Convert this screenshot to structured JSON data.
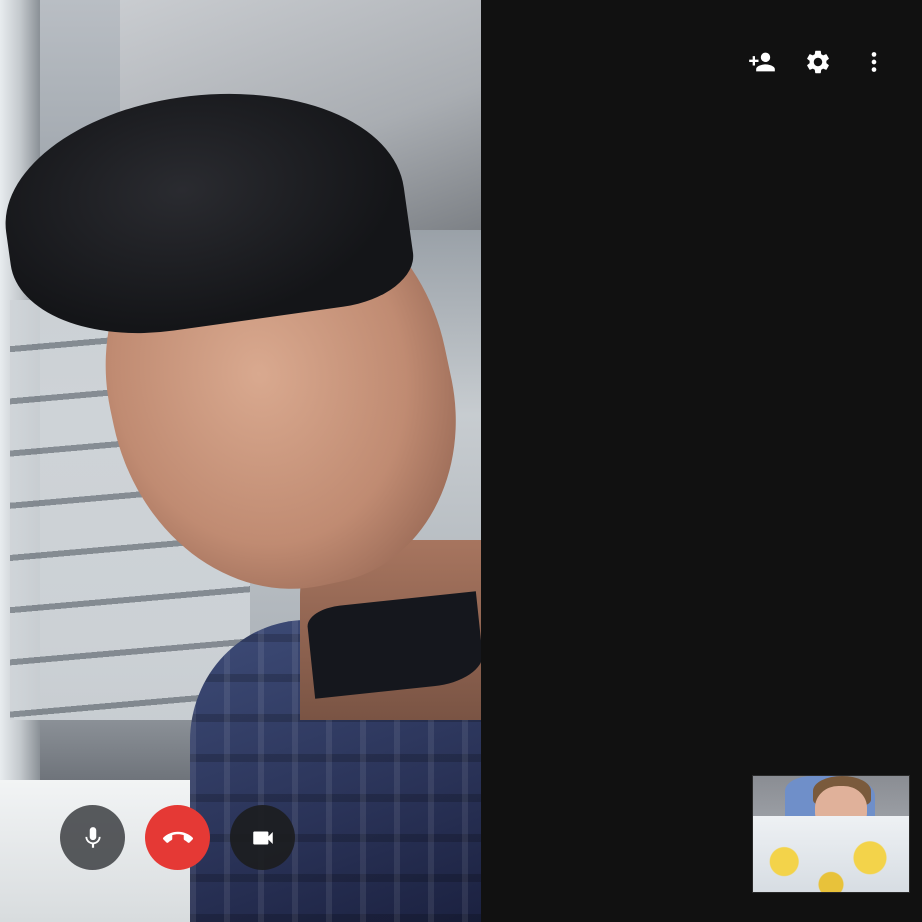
{
  "toolbar": {
    "add_person_icon": "person-add-icon",
    "settings_icon": "gear-icon",
    "more_icon": "more-vert-icon"
  },
  "controls": {
    "mic_icon": "microphone-icon",
    "hangup_icon": "phone-hangup-icon",
    "video_icon": "videocam-icon",
    "hangup_color": "#e53935"
  },
  "theme": {
    "background": "#111111",
    "icon_color": "#ffffff"
  }
}
